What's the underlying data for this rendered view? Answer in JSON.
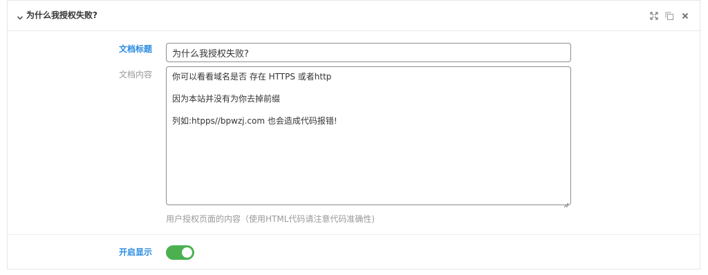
{
  "panel": {
    "title": "为什么我授权失败?",
    "icons": {
      "collapse": "chevron-down-icon",
      "expand": "expand-icon",
      "copy": "copy-icon",
      "close": "close-icon"
    }
  },
  "form": {
    "title_label": "文档标题",
    "title_value": "为什么我授权失败?",
    "content_label": "文档内容",
    "content_lines": [
      "你可以看看域名是否 存在 HTTPS 或者http",
      "因为本站并没有为你去掉前缀",
      "列如:htpps//bpwzj.com 也会造成代码报错!"
    ],
    "help_text": "用户授权页面的内容（使用HTML代码请注意代码准确性)",
    "enable_label": "开启显示",
    "enable_on": true
  },
  "colors": {
    "accent": "#2a8be0",
    "toggle_on": "#4cb050"
  }
}
